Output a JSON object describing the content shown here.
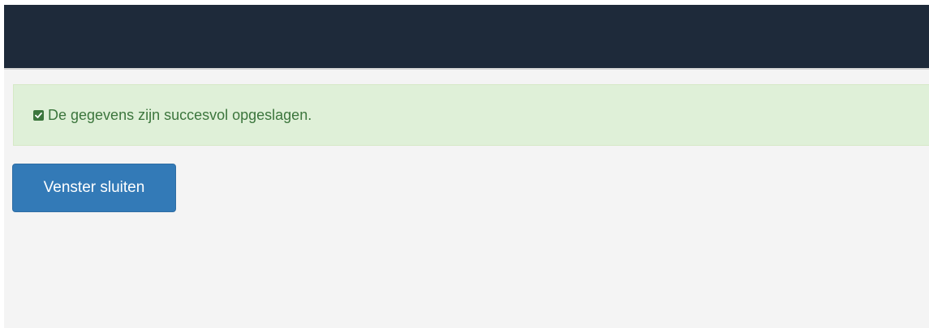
{
  "alert": {
    "icon": "check-square-icon",
    "message": "De gegevens zijn succesvol opgeslagen."
  },
  "actions": {
    "close_window_label": "Venster sluiten"
  },
  "colors": {
    "navbar": "#1e2a3a",
    "alert_background": "#dff0d8",
    "alert_text": "#3c763d",
    "primary_button": "#337ab7",
    "page_background": "#f4f4f4"
  }
}
